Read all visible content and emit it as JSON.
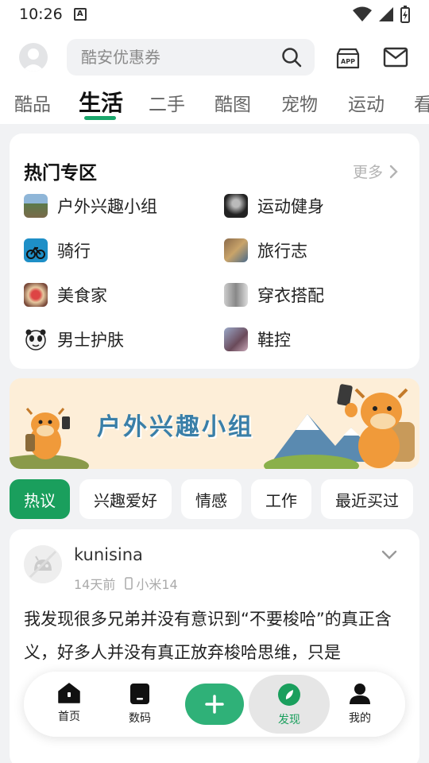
{
  "status": {
    "time": "10:26"
  },
  "header": {
    "search_placeholder": "酷安优惠券"
  },
  "tabs": [
    {
      "label": "酷品",
      "active": false
    },
    {
      "label": "生活",
      "active": true
    },
    {
      "label": "二手",
      "active": false
    },
    {
      "label": "酷图",
      "active": false
    },
    {
      "label": "宠物",
      "active": false
    },
    {
      "label": "运动",
      "active": false
    },
    {
      "label": "看",
      "active": false
    }
  ],
  "hot": {
    "title": "热门专区",
    "more": "更多",
    "items": [
      {
        "label": "户外兴趣小组",
        "icon": "mountain-thumb"
      },
      {
        "label": "运动健身",
        "icon": "gym-thumb"
      },
      {
        "label": "骑行",
        "icon": "bike-thumb"
      },
      {
        "label": "旅行志",
        "icon": "travel-thumb"
      },
      {
        "label": "美食家",
        "icon": "food-thumb"
      },
      {
        "label": "穿衣搭配",
        "icon": "fashion-thumb"
      },
      {
        "label": "男士护肤",
        "icon": "panda-thumb"
      },
      {
        "label": "鞋控",
        "icon": "shoe-thumb"
      }
    ]
  },
  "banner": {
    "title": "户外兴趣小组"
  },
  "chips": [
    {
      "label": "热议",
      "active": true
    },
    {
      "label": "兴趣爱好",
      "active": false
    },
    {
      "label": "情感",
      "active": false
    },
    {
      "label": "工作",
      "active": false
    },
    {
      "label": "最近买过",
      "active": false
    }
  ],
  "post": {
    "user": "kunisina",
    "time": "14天前",
    "device": "小米14",
    "body": "我发现很多兄弟并没有意识到“不要梭哈”的真正含义，好多人并没有真正放弃梭哈思维，只是"
  },
  "nav": {
    "home": "首页",
    "digital": "数码",
    "discover": "发现",
    "mine": "我的"
  },
  "colors": {
    "accent": "#1a9f5d",
    "add_button": "#2fb178",
    "banner_bg": "#fdeed8"
  }
}
